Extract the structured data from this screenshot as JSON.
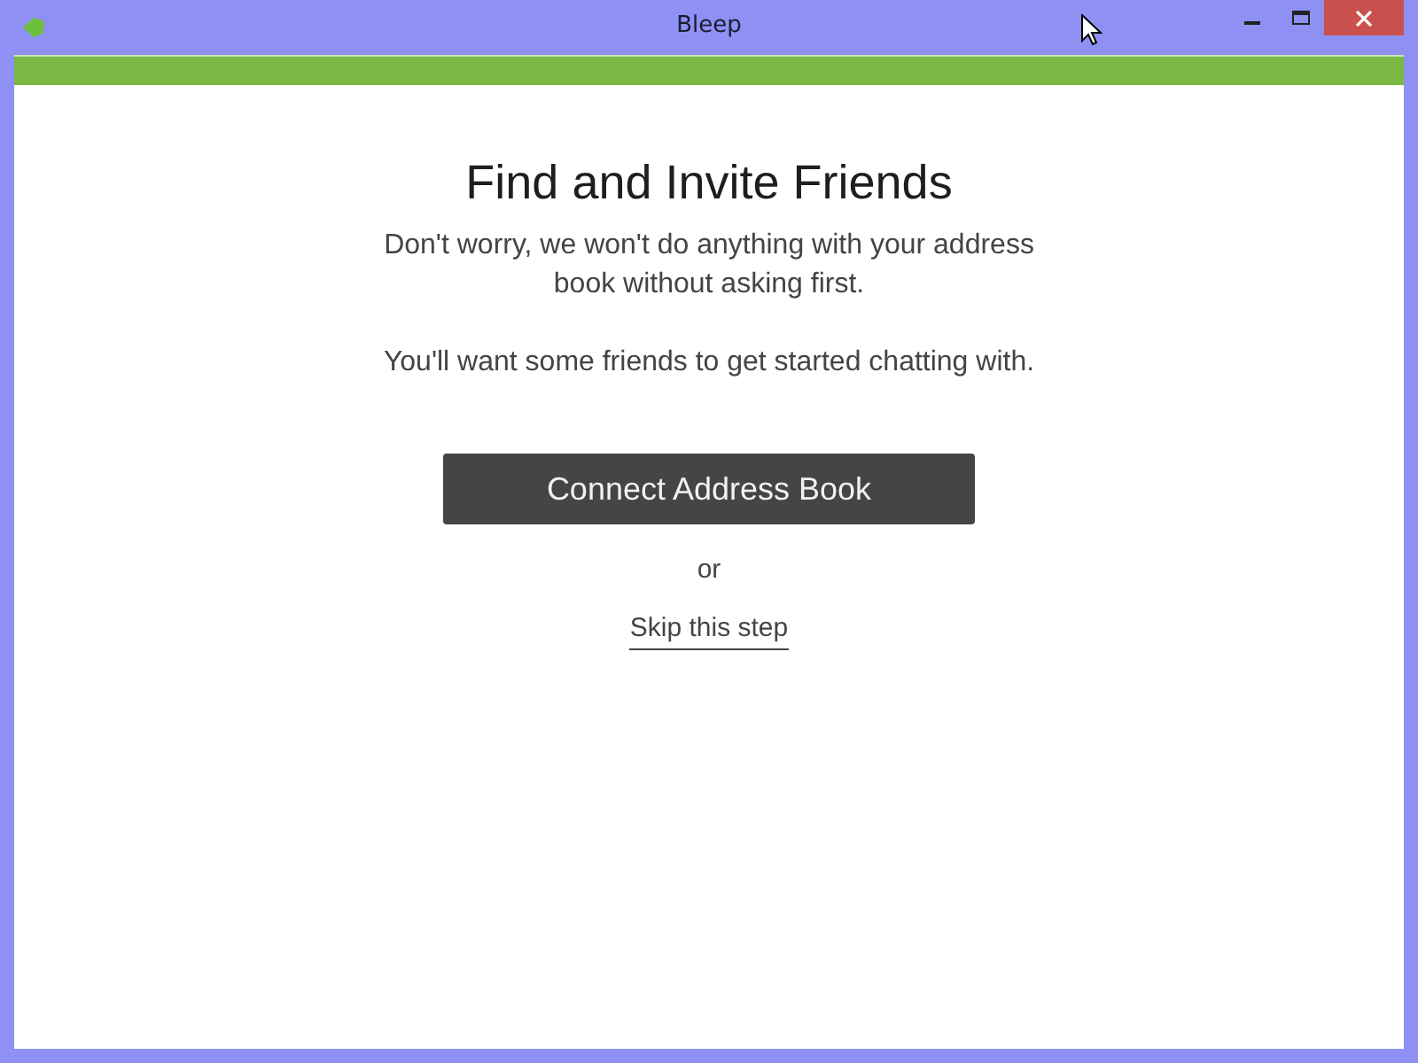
{
  "window": {
    "title": "Bleep"
  },
  "content": {
    "heading": "Find and Invite Friends",
    "paragraphs": [
      "Don't worry, we won't do anything with your address book without asking first.",
      "You'll want some friends to get started chatting with."
    ],
    "primary_button": "Connect Address Book",
    "separator": "or",
    "skip_link": "Skip this step"
  }
}
